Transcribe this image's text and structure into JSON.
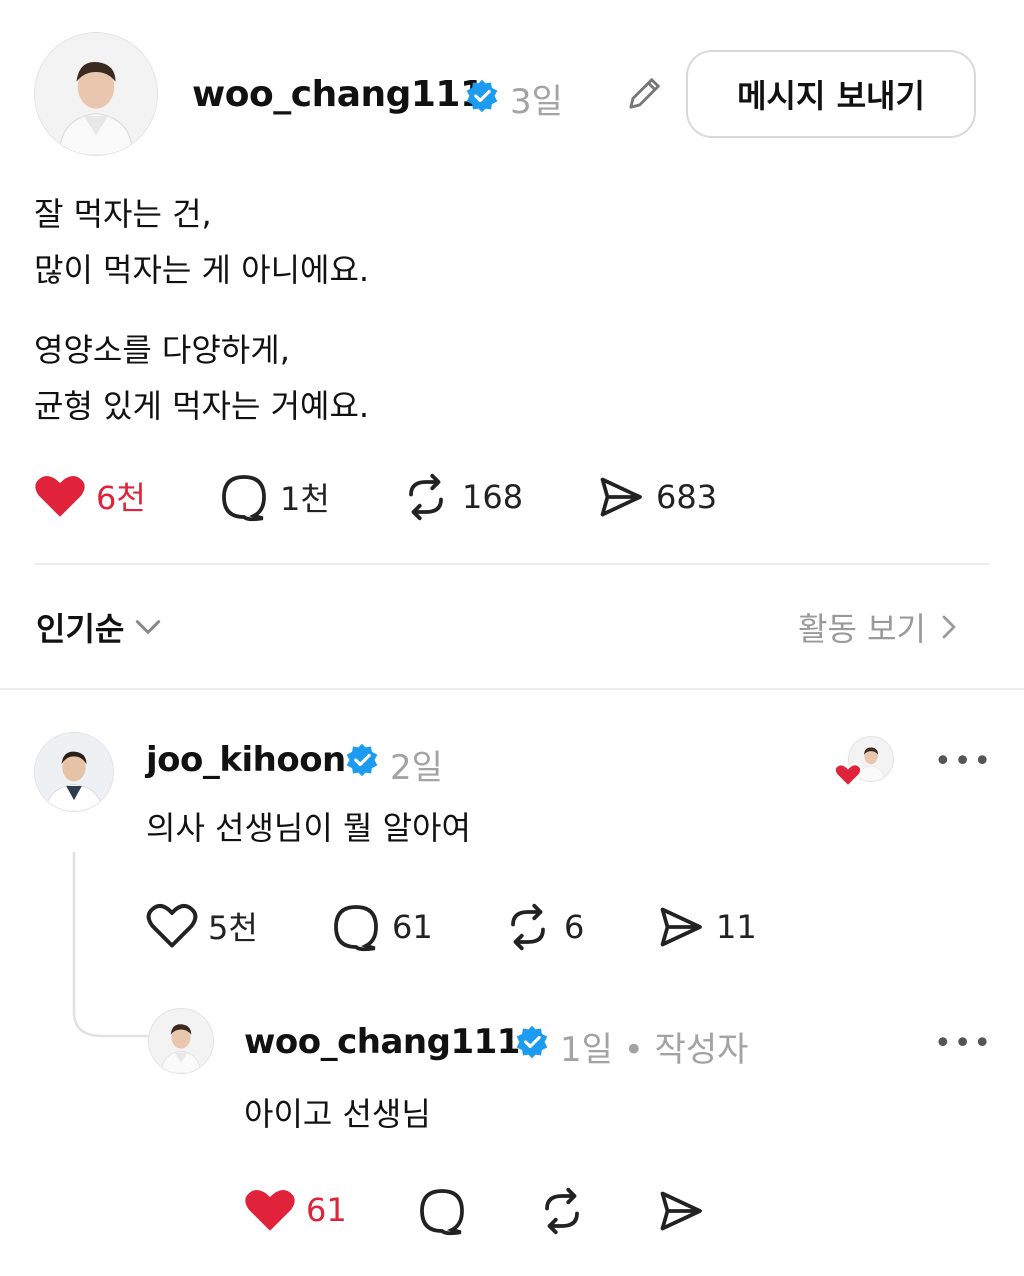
{
  "post": {
    "username": "woo_chang111",
    "time": "3일",
    "message_button": "메시지 보내기",
    "paragraph1": [
      "잘 먹자는 건,",
      "많이 먹자는 게 아니에요."
    ],
    "paragraph2": [
      "영양소를 다양하게,",
      "균형 있게 먹자는 거예요."
    ],
    "stats": {
      "likes": "6천",
      "comments": "1천",
      "reposts": "168",
      "shares": "683"
    },
    "liked": true
  },
  "sort": {
    "label": "인기순",
    "activity_label": "활동 보기"
  },
  "reply": {
    "username": "joo_kihoon",
    "time": "2일",
    "text": "의사 선생님이 뭘 알아여",
    "stats": {
      "likes": "5천",
      "comments": "61",
      "reposts": "6",
      "shares": "11"
    },
    "more": "•••"
  },
  "nested_reply": {
    "username": "woo_chang111",
    "time": "1일 • 작성자",
    "text": "아이고 선생님",
    "stats": {
      "likes": "61"
    },
    "more": "•••"
  },
  "colors": {
    "accent_red": "#e0223a",
    "verified_blue": "#1d9bf0",
    "muted": "#a3a3a3"
  },
  "icons": [
    "heart-icon",
    "comment-icon",
    "repost-icon",
    "share-icon",
    "pencil-icon",
    "verified-icon",
    "chevron-down-icon",
    "chevron-right-icon",
    "more-icon"
  ]
}
